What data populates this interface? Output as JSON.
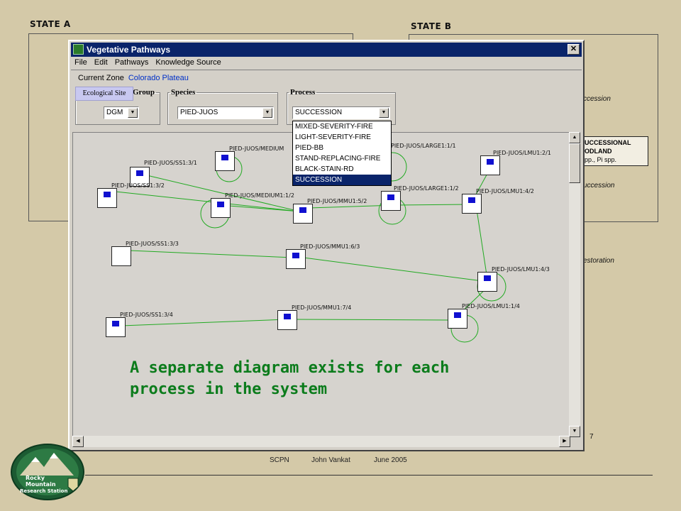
{
  "slide": {
    "state_a_label": "STATE A",
    "state_b_label": "STATE B",
    "bg_succession_1": "ccession",
    "bg_succession_2": "uccession",
    "bg_restoration": "estoration",
    "bg_number": "7",
    "bg_class_line1": "UCCESSIONAL",
    "bg_class_line2": "ODLAND",
    "bg_class_line3": "pp., Pi spp.",
    "footer": [
      "SCPN",
      "John Vankat",
      "June  2005"
    ],
    "logo_text": [
      "Rocky",
      "Mountain",
      "Research Station"
    ]
  },
  "window": {
    "title": "Vegetative Pathways",
    "menu": [
      "File",
      "Edit",
      "Pathways",
      "Knowledge Source"
    ],
    "current_zone_label": "Current Zone",
    "current_zone_value": "Colorado Plateau",
    "ecological_site_tab": "Ecological Site",
    "group": {
      "legend": "Group",
      "value": "DGM"
    },
    "species": {
      "legend": "Species",
      "value": "PIED-JUOS"
    },
    "process": {
      "legend": "Process",
      "value": "SUCCESSION",
      "options": [
        "MIXED-SEVERITY-FIRE",
        "LIGHT-SEVERITY-FIRE",
        "PIED-BB",
        "STAND-REPLACING-FIRE",
        "BLACK-STAIN-RD",
        "SUCCESSION"
      ],
      "selected": "SUCCESSION"
    },
    "nodes": [
      {
        "id": "ss1_3_1",
        "label": "PIED-JUOS/SS1:3/1"
      },
      {
        "id": "ss1_3_2",
        "label": "PIED-JUOS/SS1:3/2"
      },
      {
        "id": "medium_1_1",
        "label": "PIED-JUOS/MEDIUM"
      },
      {
        "id": "medium_1_2",
        "label": "PIED-JUOS/MEDIUM1:1/2"
      },
      {
        "id": "mmu_5_2",
        "label": "PIED-JUOS/MMU1:5/2"
      },
      {
        "id": "large_1_1",
        "label": "PIED-JUOS/LARGE1:1/1"
      },
      {
        "id": "large_1_2",
        "label": "PIED-JUOS/LARGE1:1/2"
      },
      {
        "id": "lmu_2_1",
        "label": "PIED-JUOS/LMU1:2/1"
      },
      {
        "id": "lmu_4_2",
        "label": "PIED-JUOS/LMU1:4/2"
      },
      {
        "id": "ss1_3_3",
        "label": "PIED-JUOS/SS1:3/3"
      },
      {
        "id": "mmu_6_3",
        "label": "PIED-JUOS/MMU1:6/3"
      },
      {
        "id": "lmu_4_3",
        "label": "PIED-JUOS/LMU1:4/3"
      },
      {
        "id": "ss1_3_4",
        "label": "PIED-JUOS/SS1:3/4"
      },
      {
        "id": "mmu_7_4",
        "label": "PIED-JUOS/MMU1:7/4"
      },
      {
        "id": "lmu_1_4",
        "label": "PIED-JUOS/LMU1:1/4"
      }
    ]
  },
  "overlay_caption": "A separate diagram exists for each process in the system",
  "colors": {
    "title_bar": "#0a246a",
    "arrow": "#22aa22",
    "caption": "#0c7c1c",
    "slide_bg": "#d4c9a8"
  }
}
